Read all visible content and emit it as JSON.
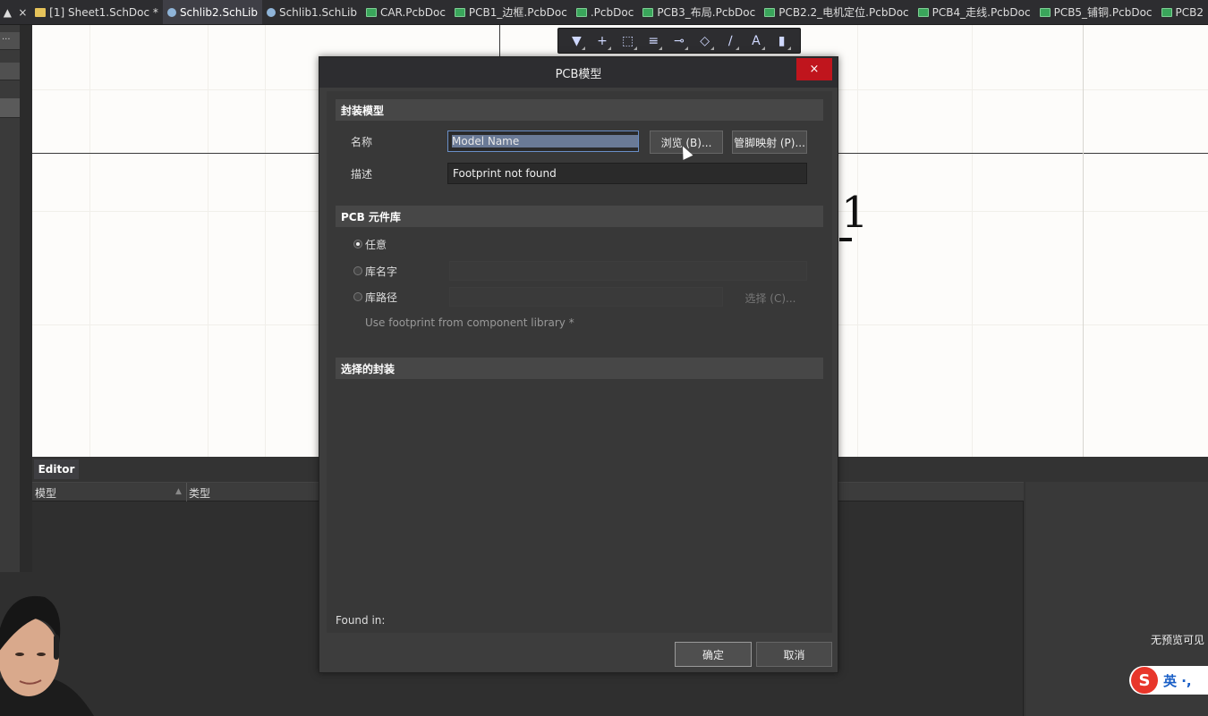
{
  "tabs": {
    "control_left": "▲",
    "control_close": "×",
    "items": [
      {
        "label": "[1] Sheet1.SchDoc *",
        "kind": "sch",
        "active": false
      },
      {
        "label": "Schlib2.SchLib",
        "kind": "lib",
        "active": true
      },
      {
        "label": "Schlib1.SchLib",
        "kind": "lib",
        "active": false
      },
      {
        "label": "CAR.PcbDoc",
        "kind": "pcb",
        "active": false
      },
      {
        "label": "PCB1_边框.PcbDoc",
        "kind": "pcb",
        "active": false
      },
      {
        "label": ".PcbDoc",
        "kind": "pcb",
        "active": false
      },
      {
        "label": "PCB3_布局.PcbDoc",
        "kind": "pcb",
        "active": false
      },
      {
        "label": "PCB2.2_电机定位.PcbDoc",
        "kind": "pcb",
        "active": false
      },
      {
        "label": "PCB4_走线.PcbDoc",
        "kind": "pcb",
        "active": false
      },
      {
        "label": "PCB5_铺铜.PcbDoc",
        "kind": "pcb",
        "active": false
      },
      {
        "label": "PCB2",
        "kind": "pcb",
        "active": false
      }
    ]
  },
  "left_strip": {
    "button_label": "..."
  },
  "canvas": {
    "pin_number": "1"
  },
  "toolbar": {
    "icons": [
      "filter-icon",
      "plus-icon",
      "select-rect-icon",
      "align-icon",
      "pin-icon",
      "fill-icon",
      "line-icon",
      "text-icon",
      "component-icon"
    ],
    "glyphs": [
      "▼",
      "+",
      "⬚",
      "≡",
      "⊸",
      "◇",
      "∕",
      "A",
      "▮"
    ]
  },
  "editor": {
    "tab_label": "Editor",
    "columns": [
      "模型",
      "类型"
    ],
    "no_preview": "无预览可见"
  },
  "ime": {
    "logo": "S",
    "text": "英 ·,"
  },
  "dialog": {
    "title": "PCB模型",
    "close": "×",
    "sections": {
      "footprint_model": "封装模型",
      "pcb_library": "PCB 元件库",
      "selected_footprint": "选择的封装"
    },
    "name_label": "名称",
    "name_placeholder": "Model Name",
    "browse_button": "浏览 (B)...",
    "pin_map_button": "管脚映射 (P)...",
    "description_label": "描述",
    "description_value": "Footprint not found",
    "radio_any": "任意",
    "radio_lib_name": "库名字",
    "radio_lib_path": "库路径",
    "choose_button": "选择 (C)...",
    "hint": "Use footprint from component library *",
    "found_in": "Found in:",
    "ok_button": "确定",
    "cancel_button": "取消"
  }
}
